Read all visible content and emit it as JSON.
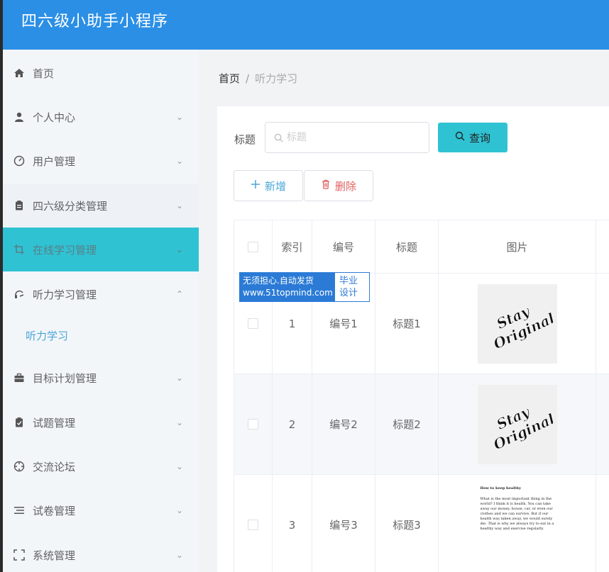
{
  "app": {
    "title": "四六级小助手小程序"
  },
  "sidebar": {
    "items": [
      {
        "label": "首页",
        "icon": "home-icon",
        "has_arrow": false
      },
      {
        "label": "个人中心",
        "icon": "user-icon",
        "has_arrow": true
      },
      {
        "label": "用户管理",
        "icon": "gauge-icon",
        "has_arrow": true
      },
      {
        "label": "四六级分类管理",
        "icon": "clipboard-icon",
        "has_arrow": true
      },
      {
        "label": "在线学习管理",
        "icon": "crop-icon",
        "has_arrow": true
      },
      {
        "label": "听力学习管理",
        "icon": "headset-icon",
        "has_arrow": true
      },
      {
        "label": "目标计划管理",
        "icon": "briefcase-icon",
        "has_arrow": true
      },
      {
        "label": "试题管理",
        "icon": "checklist-icon",
        "has_arrow": true
      },
      {
        "label": "交流论坛",
        "icon": "target-icon",
        "has_arrow": true
      },
      {
        "label": "试卷管理",
        "icon": "list-icon",
        "has_arrow": true
      },
      {
        "label": "系统管理",
        "icon": "fullscreen-icon",
        "has_arrow": true
      }
    ],
    "sub_item": {
      "label": "听力学习"
    },
    "active_color": "#2fc2d3"
  },
  "breadcrumb": {
    "home": "首页",
    "separator": "/",
    "current": "听力学习"
  },
  "search": {
    "label": "标题",
    "placeholder": "标题",
    "button": "查询"
  },
  "toolbar": {
    "add": "新增",
    "delete": "删除"
  },
  "table": {
    "headers": [
      "索引",
      "编号",
      "标题",
      "图片"
    ],
    "rows": [
      {
        "index": "1",
        "code": "编号1",
        "title": "标题1",
        "image": "stay-original"
      },
      {
        "index": "2",
        "code": "编号2",
        "title": "标题2",
        "image": "stay-original"
      },
      {
        "index": "3",
        "code": "编号3",
        "title": "标题3",
        "image": "document"
      }
    ]
  },
  "thumb_text": {
    "lettering": "Stay Original",
    "doc_title": "How to keep healthy",
    "doc_body": "What is the most important thing in the world? I think it is health. You can take away our money, house, car, or even our clothes and we can survive. But if our health was taken away, we would surely die. That is why we always try to eat in a healthy way and exercise regularly."
  },
  "watermark": {
    "line1": "无须担心.自动发货",
    "line2": "www.51topmind.com",
    "right1": "毕业",
    "right2": "设计"
  },
  "colors": {
    "header": "#2b8fe6",
    "accent": "#2fc2d3",
    "link": "#4aa6d8",
    "danger": "#e06060"
  }
}
